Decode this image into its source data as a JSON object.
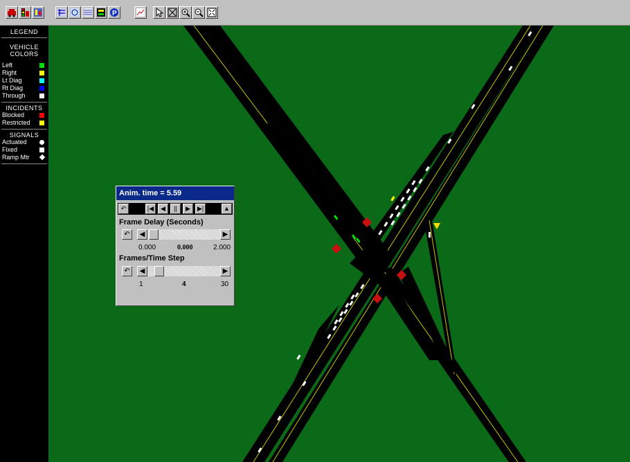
{
  "toolbar": {
    "buttons": [
      "car-icon",
      "traffic-light-icon",
      "phase-icon",
      "network-icon",
      "detector-icon",
      "table-icon",
      "timing-icon",
      "parking-icon",
      "chart-icon",
      "pointer-icon",
      "fit-window-icon",
      "zoom-in-icon",
      "zoom-out-icon",
      "full-extent-icon"
    ]
  },
  "legend": {
    "title": "LEGEND",
    "vehicle_heading_1": "VEHICLE",
    "vehicle_heading_2": "COLORS",
    "vehicle_colors": [
      {
        "label": "Left",
        "color": "#00e000"
      },
      {
        "label": "Right",
        "color": "#ffff00"
      },
      {
        "label": "Lt Diag",
        "color": "#00ffff"
      },
      {
        "label": "Rt Diag",
        "color": "#0000ff"
      },
      {
        "label": "Through",
        "color": "#ffffff"
      }
    ],
    "incidents_heading": "INCIDENTS",
    "incidents": [
      {
        "label": "Blocked",
        "color": "#ff0000"
      },
      {
        "label": "Restricted",
        "color": "#ffff00"
      }
    ],
    "signals_heading": "SIGNALS",
    "signals": [
      {
        "label": "Actuated",
        "shape": "circle"
      },
      {
        "label": "Fixed",
        "shape": "square"
      },
      {
        "label": "Ramp Mtr",
        "shape": "diamond"
      }
    ]
  },
  "anim": {
    "title": "Anim. time = 5.59",
    "frame_delay": {
      "label": "Frame Delay (Seconds)",
      "min": "0.000",
      "current": "0.000",
      "max": "2.000"
    },
    "frames_step": {
      "label": "Frames/Time Step",
      "min": "1",
      "current": "4",
      "max": "30"
    }
  },
  "colors": {
    "grass": "#0b6a18",
    "road": "#000000",
    "edge": "#d8d800"
  }
}
